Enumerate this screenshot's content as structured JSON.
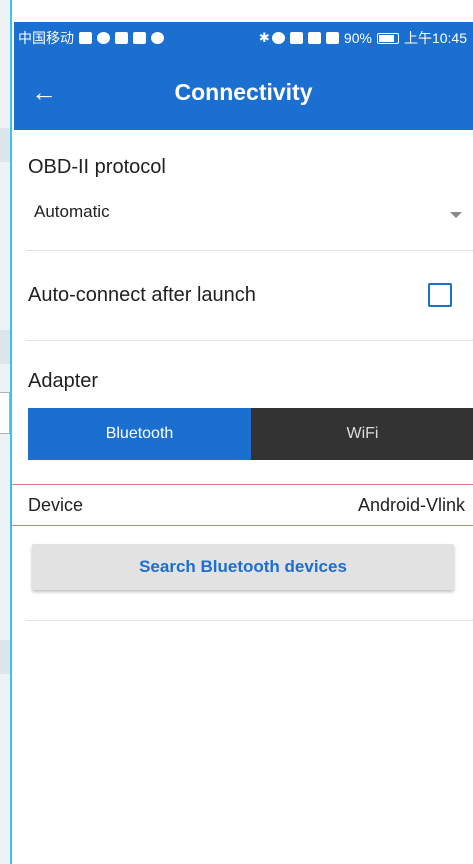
{
  "status_bar": {
    "carrier": "中国移动",
    "battery": "90%",
    "time": "上午10:45"
  },
  "app_bar": {
    "back_glyph": "←",
    "title": "Connectivity"
  },
  "protocol": {
    "label": "OBD-II protocol",
    "value": "Automatic"
  },
  "auto_connect": {
    "label": "Auto-connect after launch",
    "checked": false
  },
  "adapter": {
    "label": "Adapter",
    "options": [
      "Bluetooth",
      "WiFi"
    ],
    "selected": "Bluetooth"
  },
  "device": {
    "label": "Device",
    "value": "Android-Vlink"
  },
  "search_button": {
    "label": "Search Bluetooth devices"
  },
  "colors": {
    "primary": "#1a6fd0",
    "inactive_segment": "#333333",
    "highlight_border": "#e07a7a"
  }
}
